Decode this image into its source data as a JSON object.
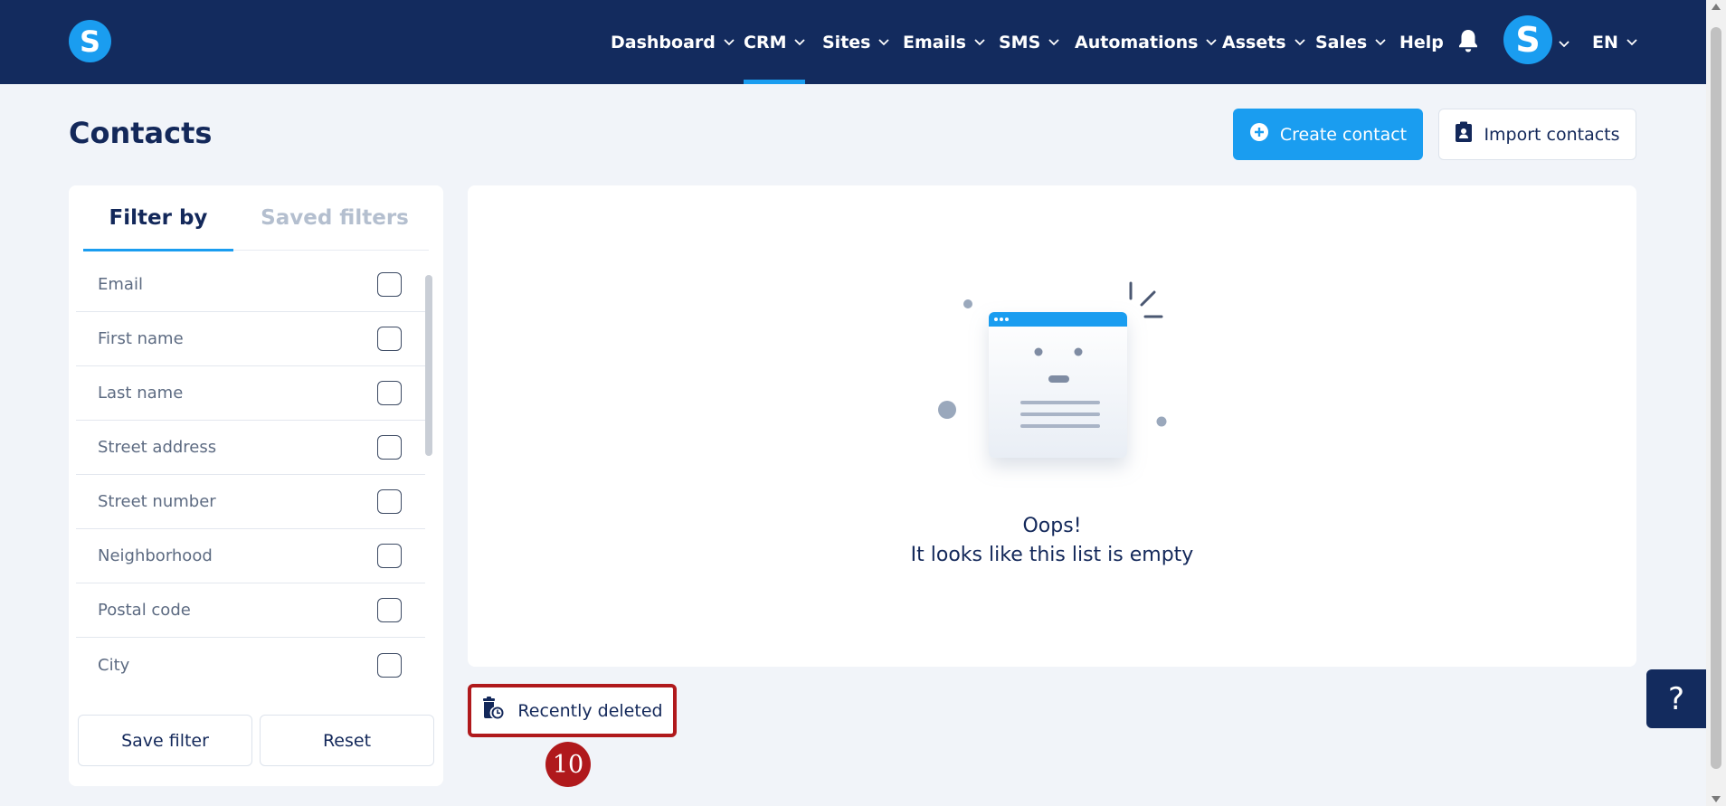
{
  "brand": {
    "logo_letter": "S"
  },
  "nav": {
    "items": [
      {
        "label": "Dashboard",
        "has_chevron": true
      },
      {
        "label": "CRM",
        "has_chevron": true,
        "active": true
      },
      {
        "label": "Sites",
        "has_chevron": true
      },
      {
        "label": "Emails",
        "has_chevron": true
      },
      {
        "label": "SMS",
        "has_chevron": true
      },
      {
        "label": "Automations",
        "has_chevron": true
      },
      {
        "label": "Assets",
        "has_chevron": true
      },
      {
        "label": "Sales",
        "has_chevron": true
      },
      {
        "label": "Help",
        "has_chevron": false
      }
    ],
    "notification_icon": "bell-icon",
    "avatar_letter": "S",
    "language": "EN"
  },
  "page": {
    "title": "Contacts",
    "create_button": "Create contact",
    "import_button": "Import contacts"
  },
  "filters": {
    "tabs": [
      {
        "label": "Filter by",
        "active": true
      },
      {
        "label": "Saved filters",
        "active": false
      }
    ],
    "fields": [
      {
        "label": "Email",
        "checked": false
      },
      {
        "label": "First name",
        "checked": false
      },
      {
        "label": "Last name",
        "checked": false
      },
      {
        "label": "Street address",
        "checked": false
      },
      {
        "label": "Street number",
        "checked": false
      },
      {
        "label": "Neighborhood",
        "checked": false
      },
      {
        "label": "Postal code",
        "checked": false
      },
      {
        "label": "City",
        "checked": false
      }
    ],
    "save_button": "Save filter",
    "reset_button": "Reset"
  },
  "empty_state": {
    "line1": "Oops!",
    "line2": "It looks like this list is empty"
  },
  "recently_deleted": {
    "label": "Recently deleted",
    "step_number": "10"
  },
  "help_widget": {
    "label": "?"
  },
  "colors": {
    "nav_bg": "#132b5e",
    "accent": "#1a9df0",
    "highlight": "#b0191c",
    "page_bg": "#f1f4f9"
  }
}
